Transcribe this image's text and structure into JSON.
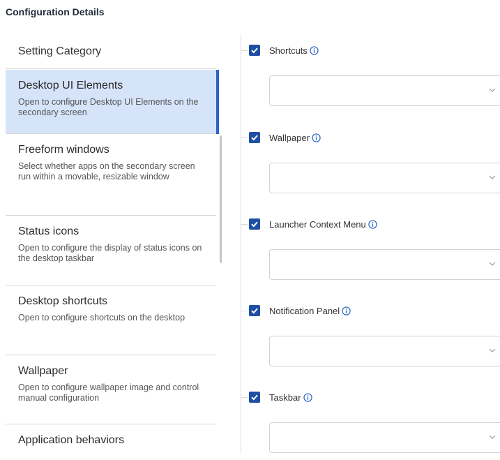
{
  "page": {
    "title": "Configuration Details"
  },
  "categories": {
    "header": "Setting Category",
    "items": [
      {
        "title": "Desktop UI Elements",
        "desc": "Open to configure Desktop UI Elements on the secondary screen",
        "selected": true
      },
      {
        "title": "Freeform windows",
        "desc": "Select whether apps on the secondary screen run within a movable, resizable window"
      },
      {
        "title": "Status icons",
        "desc": "Open to configure the display of status icons on the desktop taskbar"
      },
      {
        "title": "Desktop shortcuts",
        "desc": "Open to configure shortcuts on the desktop"
      },
      {
        "title": "Wallpaper",
        "desc": "Open to configure wallpaper image and control manual configuration"
      },
      {
        "title": "Application behaviors",
        "desc": ""
      }
    ]
  },
  "settings": [
    {
      "label": "Shortcuts",
      "checked": true,
      "value": ""
    },
    {
      "label": "Wallpaper",
      "checked": true,
      "value": ""
    },
    {
      "label": "Launcher Context Menu",
      "checked": true,
      "value": ""
    },
    {
      "label": "Notification Panel",
      "checked": true,
      "value": ""
    },
    {
      "label": "Taskbar",
      "checked": true,
      "value": ""
    }
  ],
  "colors": {
    "accent": "#1f4fa3",
    "selected_bg": "#d6e4fa",
    "info": "#2b63c6"
  },
  "icons": {
    "info": "info-icon",
    "check": "checkmark-icon",
    "dropdown": "chevron-down-icon"
  }
}
